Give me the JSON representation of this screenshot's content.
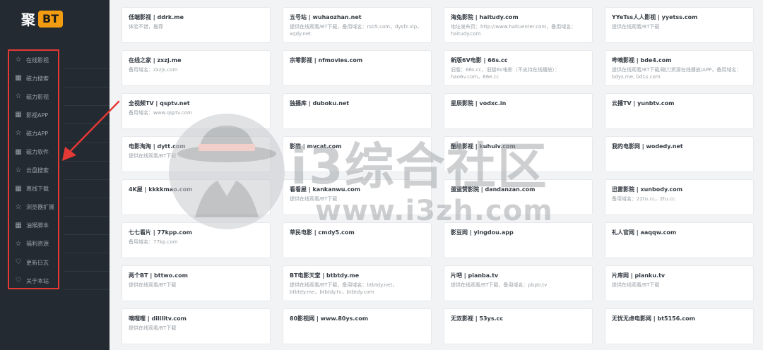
{
  "logo": {
    "text": "聚",
    "badge": "BT"
  },
  "sidebar": {
    "items": [
      {
        "label": "在线影视",
        "icon": "star-icon"
      },
      {
        "label": "磁力搜索",
        "icon": "grid-icon"
      },
      {
        "label": "磁力影视",
        "icon": "star-icon"
      },
      {
        "label": "影视APP",
        "icon": "grid-icon"
      },
      {
        "label": "磁力APP",
        "icon": "star-icon"
      },
      {
        "label": "磁力软件",
        "icon": "grid-icon"
      },
      {
        "label": "云盘搜索",
        "icon": "star-icon"
      },
      {
        "label": "离线下载",
        "icon": "grid-icon"
      },
      {
        "label": "浏览器扩展",
        "icon": "star-icon"
      },
      {
        "label": "油猴脚本",
        "icon": "grid-icon"
      },
      {
        "label": "福利资源",
        "icon": "star-icon"
      },
      {
        "label": "更新日志",
        "icon": "heart-icon"
      },
      {
        "label": "关于本站",
        "icon": "heart-icon"
      }
    ]
  },
  "sites": [
    {
      "title": "低端影视 | ddrk.me",
      "desc": "体验不错，推荐"
    },
    {
      "title": "五号站 | wuhaozhan.net",
      "desc": "提供在线观看/BT下载，备用域名：rs05.com，dysfz.vip，xqdy.net"
    },
    {
      "title": "海兔影院 | haitudy.com",
      "desc": "地址发布页：http://www.haituenter.com，备用域名：haitudy.com"
    },
    {
      "title": "YYeTss人人影视 | yyetss.com",
      "desc": "提供在线观看/BT下载"
    },
    {
      "title": "在线之家 | zxzj.me",
      "desc": "备用域名：zxzjs.com"
    },
    {
      "title": "宗零影视 | nfmovies.com",
      "desc": ""
    },
    {
      "title": "新版6V电影 | 66s.cc",
      "desc": "旧版：66s.cc，旧版6V电影（不支持在线播放）：hao6v.com，66e.cc"
    },
    {
      "title": "哔嘀影视 | bde4.com",
      "desc": "提供在线观看/BT下载/磁力资源在线播放/APP，备用域名：bdys.me, bd1s.com"
    },
    {
      "title": "全视频TV | qsptv.net",
      "desc": "备用域名：www.qsptv.com"
    },
    {
      "title": "独播库 | duboku.net",
      "desc": ""
    },
    {
      "title": "星辰影院 | vodxc.in",
      "desc": ""
    },
    {
      "title": "云播TV | yunbtv.com",
      "desc": ""
    },
    {
      "title": "电影淘淘 | dytt.com",
      "desc": "提供在线观看/BT下载"
    },
    {
      "title": "影猫 | mvcat.com",
      "desc": ""
    },
    {
      "title": "酷绘影视 | kuhuiv.com",
      "desc": ""
    },
    {
      "title": "我的电影网 | wodedy.net",
      "desc": ""
    },
    {
      "title": "4K屋 | kkkkmao.com",
      "desc": ""
    },
    {
      "title": "看看屋 | kankanwu.com",
      "desc": "提供在线观看/BT下载"
    },
    {
      "title": "蛋蛋赞影院 | dandanzan.com",
      "desc": ""
    },
    {
      "title": "迅雷影院 | xunbody.com",
      "desc": "备用域名：22tu.cc，2tu.cc"
    },
    {
      "title": "七七看片 | 77kpp.com",
      "desc": "备用域名：77kp.com"
    },
    {
      "title": "草民电影 | cmdy5.com",
      "desc": ""
    },
    {
      "title": "影豆网 | yingdou.app",
      "desc": ""
    },
    {
      "title": "礼人官网 | aaqqw.com",
      "desc": ""
    },
    {
      "title": "两个BT | bttwo.com",
      "desc": "提供在线观看/BT下载"
    },
    {
      "title": "BT电影天堂 | btbtdy.me",
      "desc": "提供在线观看/BT下载，备用域名：btbtdy.net，btbtdy.me，btbtdy.tv，btbtdy.com"
    },
    {
      "title": "片吧 | pianba.tv",
      "desc": "提供在线观看/BT下载，备用域名：pbpb.tv"
    },
    {
      "title": "片库网 | pianku.tv",
      "desc": "提供在线观看/BT下载"
    },
    {
      "title": "嘀哩哩 | dililitv.com",
      "desc": "提供在线观看/BT下载"
    },
    {
      "title": "80影视网 | www.80ys.com",
      "desc": ""
    },
    {
      "title": "无双影视 | 53ys.cc",
      "desc": ""
    },
    {
      "title": "无忧无虑电影网 | bt5156.com",
      "desc": ""
    }
  ],
  "watermark": {
    "cn": "i3综合社区",
    "url": "www.i3zh.com"
  },
  "colors": {
    "sidebar_bg": "#232a31",
    "accent": "#f39c12",
    "highlight": "#e53935"
  }
}
